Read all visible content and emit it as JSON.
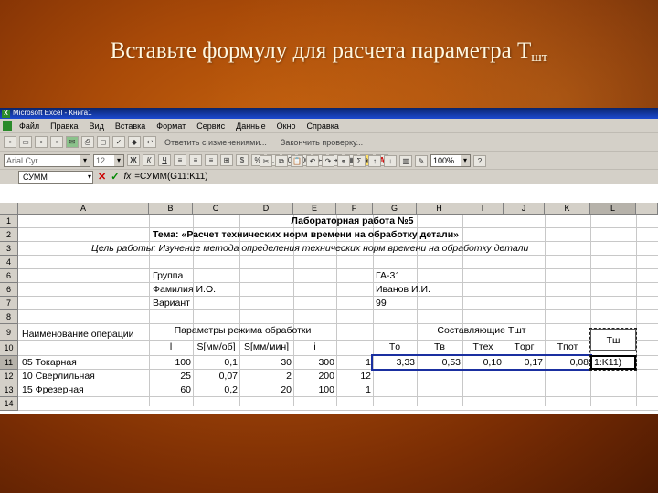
{
  "slide": {
    "title_main": "Вставьте формулу для расчета параметра Т",
    "title_sub": "шт"
  },
  "window": {
    "title": "Microsoft Excel - Книга1"
  },
  "menu": [
    "Файл",
    "Правка",
    "Вид",
    "Вставка",
    "Формат",
    "Сервис",
    "Данные",
    "Окно",
    "Справка"
  ],
  "toolbar": {
    "reply_label": "Ответить с изменениями...",
    "end_review_label": "Закончить проверку...",
    "font_name": "Arial Cyr",
    "font_size": "12",
    "zoom": "100%"
  },
  "formula_bar": {
    "name_box": "СУММ",
    "cancel_icon": "x-icon",
    "enter_icon": "check-icon",
    "fx_label": "fx",
    "formula": "=СУММ(G11:K11)"
  },
  "colors": {
    "slide_bg": "#a94a08",
    "title_text": "#fff7e0",
    "selection_border": "#1a2fa0"
  },
  "columns": [
    "A",
    "B",
    "C",
    "D",
    "E",
    "F",
    "G",
    "H",
    "I",
    "J",
    "K",
    "L"
  ],
  "rows": [
    "1",
    "2",
    "3",
    "4",
    "6",
    "6",
    "7",
    "8",
    "9",
    "10",
    "11",
    "12",
    "13",
    "14"
  ],
  "sheet": {
    "r1": {
      "title": "Лабораторная работа №5"
    },
    "r2": {
      "topic": "Тема: «Расчет технических норм времени на обработку детали»"
    },
    "r3": {
      "goal": "Цель работы: Изучение метода определения технических норм времени на обработку детали"
    },
    "r6a": {
      "label": "Группа",
      "value": "ГА-31"
    },
    "r6b": {
      "label": "Фамилия И.О.",
      "value": "Иванов И.И."
    },
    "r7": {
      "label": "Вариант",
      "value": "99"
    },
    "r9": {
      "op_header": "Наименование операции",
      "params_header": "Параметры режима обработки",
      "components_header": "Составляющие Тшт",
      "tsh_header": "Тш"
    },
    "r10": {
      "l": "l",
      "s_rev": "S[мм/об]",
      "s_min": "S[мм/мин]",
      "i": "i",
      "to": "Tо",
      "tv": "Tв",
      "tteh": "Tтех",
      "torg": "Tорг",
      "tpot": "Tпот"
    },
    "r11": {
      "op": "05 Токарная",
      "l": "100",
      "s_rev": "0,1",
      "s_min": "30",
      "i": "300",
      "f": "1",
      "to": "3,33",
      "tv": "0,53",
      "tteh": "0,10",
      "torg": "0,17",
      "tpot": "0,08",
      "active": "1:K11)"
    },
    "r12": {
      "op": "10 Сверлильная",
      "l": "25",
      "s_rev": "0,07",
      "s_min": "2",
      "i": "200",
      "f": "12"
    },
    "r13": {
      "op": "15 Фрезерная",
      "l": "60",
      "s_rev": "0,2",
      "s_min": "20",
      "i": "100",
      "f": "1"
    }
  }
}
